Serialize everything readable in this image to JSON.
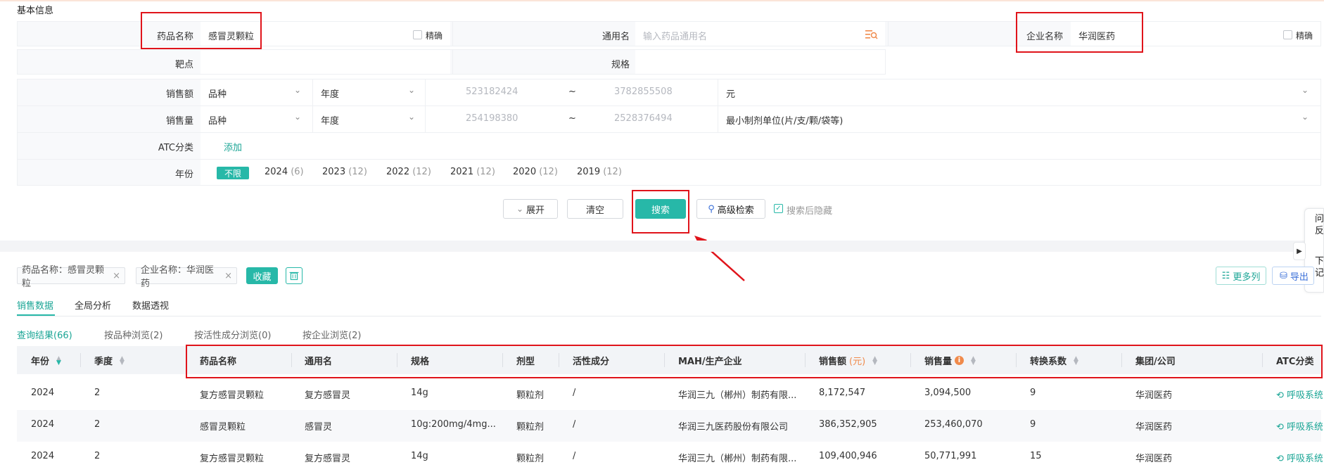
{
  "section_title": "基本信息",
  "fields": {
    "drug_name": {
      "label": "药品名称",
      "value": "感冒灵颗粒",
      "exact": "精确"
    },
    "generic_name": {
      "label": "通用名",
      "placeholder": "输入药品通用名"
    },
    "company_name": {
      "label": "企业名称",
      "value": "华润医药",
      "exact": "精确"
    },
    "target": {
      "label": "靶点"
    },
    "spec": {
      "label": "规格"
    },
    "sales_amount": {
      "label": "销售额",
      "sel1": "品种",
      "sel2": "年度",
      "min": "523182424",
      "sep": "~",
      "max": "3782855508",
      "unit": "元"
    },
    "sales_volume": {
      "label": "销售量",
      "sel1": "品种",
      "sel2": "年度",
      "min": "254198380",
      "sep": "~",
      "max": "2528376494",
      "unit": "最小制剂单位(片/支/颗/袋等)"
    },
    "atc": {
      "label": "ATC分类",
      "add": "添加"
    },
    "year": {
      "label": "年份",
      "unlimited": "不限",
      "options": [
        {
          "year": "2024",
          "count": "(6)"
        },
        {
          "year": "2023",
          "count": "(12)"
        },
        {
          "year": "2022",
          "count": "(12)"
        },
        {
          "year": "2021",
          "count": "(12)"
        },
        {
          "year": "2020",
          "count": "(12)"
        },
        {
          "year": "2019",
          "count": "(12)"
        }
      ]
    }
  },
  "actions": {
    "expand": "展开",
    "clear": "清空",
    "search": "搜索",
    "advanced": "高级检索",
    "hide_after_search": "搜索后隐藏"
  },
  "side_widget": {
    "feedback": "问反",
    "download": "下记"
  },
  "filter_tags": [
    "药品名称：感冒灵颗粒",
    "企业名称：华润医药"
  ],
  "collect": "收藏",
  "more_columns": "更多列",
  "export": "导出",
  "main_tabs": [
    "销售数据",
    "全局分析",
    "数据透视"
  ],
  "sub_tabs": [
    "查询结果",
    "按品种浏览",
    "按活性成分浏览",
    "按企业浏览"
  ],
  "sub_tab_counts": [
    "(66)",
    "(2)",
    "(0)",
    "(2)"
  ],
  "table": {
    "headers": [
      "年份",
      "季度",
      "药品名称",
      "通用名",
      "规格",
      "剂型",
      "活性成分",
      "MAH/生产企业",
      "销售额",
      "(元)",
      "销售量",
      "转换系数",
      "集团/公司",
      "ATC分类"
    ],
    "rows": [
      [
        "2024",
        "2",
        "复方感冒灵颗粒",
        "复方感冒灵",
        "14g",
        "颗粒剂",
        "/",
        "华润三九（郴州）制药有限...",
        "8,172,547",
        "3,094,500",
        "9",
        "华润医药",
        "呼吸系统"
      ],
      [
        "2024",
        "2",
        "感冒灵颗粒",
        "感冒灵",
        "10g:200mg/4mg...",
        "颗粒剂",
        "/",
        "华润三九医药股份有限公司",
        "386,352,905",
        "253,460,070",
        "9",
        "华润医药",
        "呼吸系统"
      ],
      [
        "2024",
        "2",
        "复方感冒灵颗粒",
        "复方感冒灵",
        "14g",
        "颗粒剂",
        "/",
        "华润三九（郴州）制药有限...",
        "109,400,946",
        "50,771,991",
        "15",
        "华润医药",
        "呼吸系统"
      ]
    ]
  },
  "colors": {
    "accent": "#27b8a8",
    "highlight": "#e0141b"
  }
}
